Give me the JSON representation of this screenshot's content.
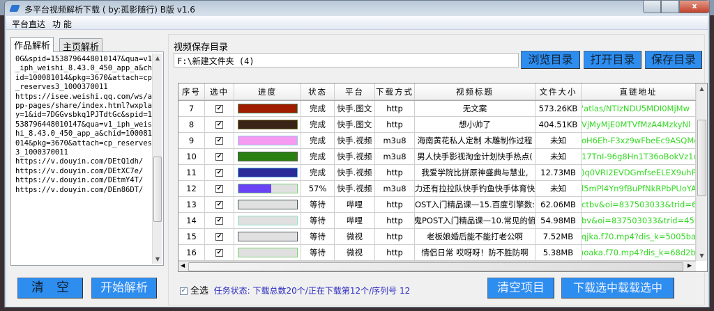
{
  "window": {
    "title": "多平台视频解析下载 ( by:孤影随行) B版 v1.6",
    "close_label": "x"
  },
  "menu": [
    "平台直达",
    "功 能"
  ],
  "left": {
    "tabs": [
      "作品解析",
      "主页解析"
    ],
    "text": "0G&spid=1538796448010147&qua=v1_iph_weishi_8.43.0_450_app_a&chid=100081014&pkg=3670&attach=cp_reserves3_1000370011\nhttps://isee.weishi.qq.com/ws/app-pages/share/index.html?wxplay=1&id=7DGGvsbkq1PJTdtGc&spid=1538796448010147&qua=v1_iph_weishi_8.43.0_450_app_a&chid=100081014&pkg=3670&attach=cp_reserves3_1000370011\nhttps://v.douyin.com/DEtQ1dh/\nhttps://v.douyin.com/DEtXC7e/\nhttps://v.douyin.com/DEtmY4T/\nhttps://v.douyin.com/DEn86DT/",
    "clear_label": "清　空",
    "parse_label": "开始解析"
  },
  "save": {
    "label": "视频保存目录",
    "path": "F:\\新建文件夹 (4)",
    "browse": "浏览目录",
    "open": "打开目录",
    "save": "保存目录"
  },
  "table": {
    "headers": [
      "序号",
      "选中",
      "进度",
      "状态",
      "平台",
      "下载方式",
      "视频标题",
      "文件大小",
      "直链地址"
    ],
    "rows": [
      {
        "no": "7",
        "checked": true,
        "progress": 100,
        "color": "#a01d00",
        "border": "#4a9a6a",
        "status": "完成",
        "platform": "快手.图文",
        "method": "http",
        "title": "无文案",
        "size": "573.26KB",
        "url": "'atlas/NTIzNDU5MDI0MjMw"
      },
      {
        "no": "8",
        "checked": true,
        "progress": 100,
        "color": "#3a2418",
        "border": "#7a7a30",
        "status": "完成",
        "platform": "快手.图文",
        "method": "http",
        "title": "想小帅了",
        "size": "404.51KB",
        "url": "VjMyMjE0MTVfMzA4MzkyNl"
      },
      {
        "no": "9",
        "checked": true,
        "progress": 100,
        "color": "#f59af0",
        "border": "#8ad0e0",
        "status": "完成",
        "platform": "快手.视频",
        "method": "m3u8",
        "title": "海南黄花私人定制 木雕制作过程",
        "size": "未知",
        "url": "oH6Eh-F3xz9wFbeEc9ASQMq"
      },
      {
        "no": "10",
        "checked": true,
        "progress": 100,
        "color": "#2a8010",
        "border": "#555",
        "status": "完成",
        "platform": "快手.视频",
        "method": "m3u8",
        "title": "男人快手影视淘金计划快手热点(",
        "size": "未知",
        "url": "17TnI-96g8Hn1T36oBokVz1c"
      },
      {
        "no": "11",
        "checked": true,
        "progress": 100,
        "color": "#2a2a98",
        "border": "#5ab0e0",
        "status": "完成",
        "platform": "快手.视频",
        "method": "http",
        "title": "我爱学院比拼原神盛典与慧业,",
        "size": "12.73MB",
        "url": ")q0VRI2EVDGmfseELEX9uhP"
      },
      {
        "no": "12",
        "checked": true,
        "progress": 57,
        "color": "#6a44f4",
        "border": "#7ad070",
        "status": "57%",
        "platform": "快手.视频",
        "method": "m3u8",
        "title": "力还有拉拉队快手钓鱼快手体育快",
        "size": "未知",
        "url": "l5mPl4Yn9fBuPfNkRPbPUoYA"
      },
      {
        "no": "13",
        "checked": true,
        "progress": 0,
        "color": "#e0e0e0",
        "border": "#4a5a5a",
        "status": "等待",
        "platform": "哔哩",
        "method": "http",
        "title": "OST入门精品课—15.百度引擎数:",
        "size": "62.06MB",
        "url": "ctbv&oi=837503033&trid=6"
      },
      {
        "no": "14",
        "checked": true,
        "progress": 0,
        "color": "#e0e0e0",
        "border": "#90e0c8",
        "status": "等待",
        "platform": "哔哩",
        "method": "http",
        "title": "鬼POST入门精品课—10.常见的俯",
        "size": "54.98MB",
        "url": "bv&oi=837503033&trid=459"
      },
      {
        "no": "15",
        "checked": true,
        "progress": 0,
        "color": "#e0e0e0",
        "border": "#555a66",
        "status": "等待",
        "platform": "微视",
        "method": "http",
        "title": "老板娘婚后能不能打老公啊",
        "size": "7.52MB",
        "url": "qjka.f70.mp4?dis_k=5005ba"
      },
      {
        "no": "16",
        "checked": true,
        "progress": 0,
        "color": "#e0e0e0",
        "border": "#7ad070",
        "status": "等待",
        "platform": "微视",
        "method": "http",
        "title": "情侣日常  哎呀呀！防不胜防啊",
        "size": "5.38MB",
        "url": "ıoaka.f70.mp4?dis_k=68d2b"
      }
    ]
  },
  "footer": {
    "select_all": "全选",
    "select_all_checked": true,
    "status": "任务状态:  下载总数20个/正在下载第12个/序列号 12",
    "clear_items": "清空项目",
    "download_selected": "下载选中载载选中"
  },
  "colors": {
    "button_blue": "#2e8ef0",
    "status_text": "#2a2ac0",
    "url_green": "#36d826"
  }
}
